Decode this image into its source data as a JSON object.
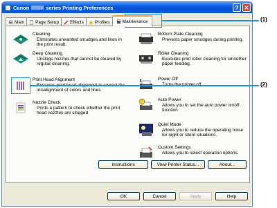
{
  "window": {
    "title_prefix": "Canon",
    "title_suffix": "series Printing Preferences",
    "help_label": "?",
    "close_label": "✕"
  },
  "tabs": [
    {
      "label": "Main",
      "icon": "printer-icon"
    },
    {
      "label": "Page Setup",
      "icon": "page-icon"
    },
    {
      "label": "Effects",
      "icon": "brush-icon"
    },
    {
      "label": "Profiles",
      "icon": "star-icon"
    },
    {
      "label": "Maintenance",
      "icon": "maintenance-icon",
      "active": true
    }
  ],
  "left_items": [
    {
      "title": "Cleaning",
      "desc": "Eliminates unwanted smudges and lines in the print result."
    },
    {
      "title": "Deep Cleaning",
      "desc": "Unclogs nozzles that cannot be cleared by regular cleaning."
    },
    {
      "title": "Print Head Alignment",
      "desc": "Executes print head alignment to correct the misalignment of colors and lines"
    },
    {
      "title": "Nozzle Check",
      "desc": "Prints a pattern to check whether the print head nozzles are clogged"
    }
  ],
  "right_items": [
    {
      "title": "Bottom Plate Cleaning",
      "desc": "Prevents paper smudges during printing."
    },
    {
      "title": "Roller Cleaning",
      "desc": "Executes print roller cleaning for smoother paper feeding."
    },
    {
      "title": "Power Off",
      "desc": "Turns the printer off."
    },
    {
      "title": "Auto Power",
      "desc": "Allows you to set the auto power on/off function"
    },
    {
      "title": "Quiet Mode",
      "desc": "Allows you to reduce the operating noise for night or silent situations."
    },
    {
      "title": "Custom Settings",
      "desc": "Allows you to select operation options."
    }
  ],
  "panel_buttons": {
    "instructions": "Instructions",
    "status": "View Printer Status...",
    "about": "About..."
  },
  "dialog_buttons": {
    "ok": "OK",
    "cancel": "Cancel",
    "apply": "Apply",
    "help": "Help"
  },
  "callouts": {
    "one": "(1)",
    "two": "(2)"
  },
  "colors": {
    "titlebar": "#0a5be0",
    "highlight": "#1e90ff",
    "active_tab_accent": "#f4a12a"
  }
}
